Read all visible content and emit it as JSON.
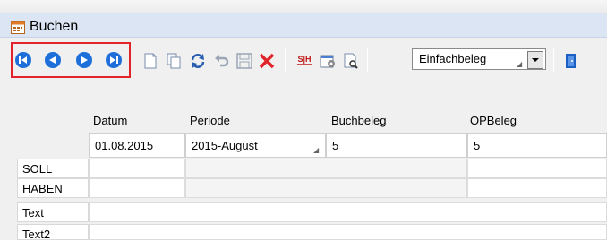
{
  "window": {
    "title": "Buchen"
  },
  "toolbar": {
    "nav_buttons": [
      "first-record-icon",
      "previous-record-icon",
      "next-record-icon",
      "last-record-icon"
    ],
    "tools": [
      "new-document-icon",
      "copy-document-icon",
      "refresh-icon",
      "undo-icon",
      "save-icon",
      "delete-icon",
      "split-icon",
      "properties-icon",
      "document-search-icon",
      "exit-icon"
    ],
    "split_label": "S|H",
    "beleg_select": {
      "value": "Einfachbeleg"
    }
  },
  "form": {
    "headers": {
      "datum": "Datum",
      "periode": "Periode",
      "buchbeleg": "Buchbeleg",
      "opbeleg": "OPBeleg"
    },
    "values": {
      "datum": "01.08.2015",
      "periode": "2015-August",
      "buchbeleg": "5",
      "opbeleg": "5"
    },
    "rows": {
      "soll": "SOLL",
      "haben": "HABEN",
      "text": "Text",
      "text2": "Text2"
    }
  },
  "colors": {
    "nav_blue": "#1e6fd9",
    "highlight": "#e0242a",
    "delete": "#e0242a"
  }
}
